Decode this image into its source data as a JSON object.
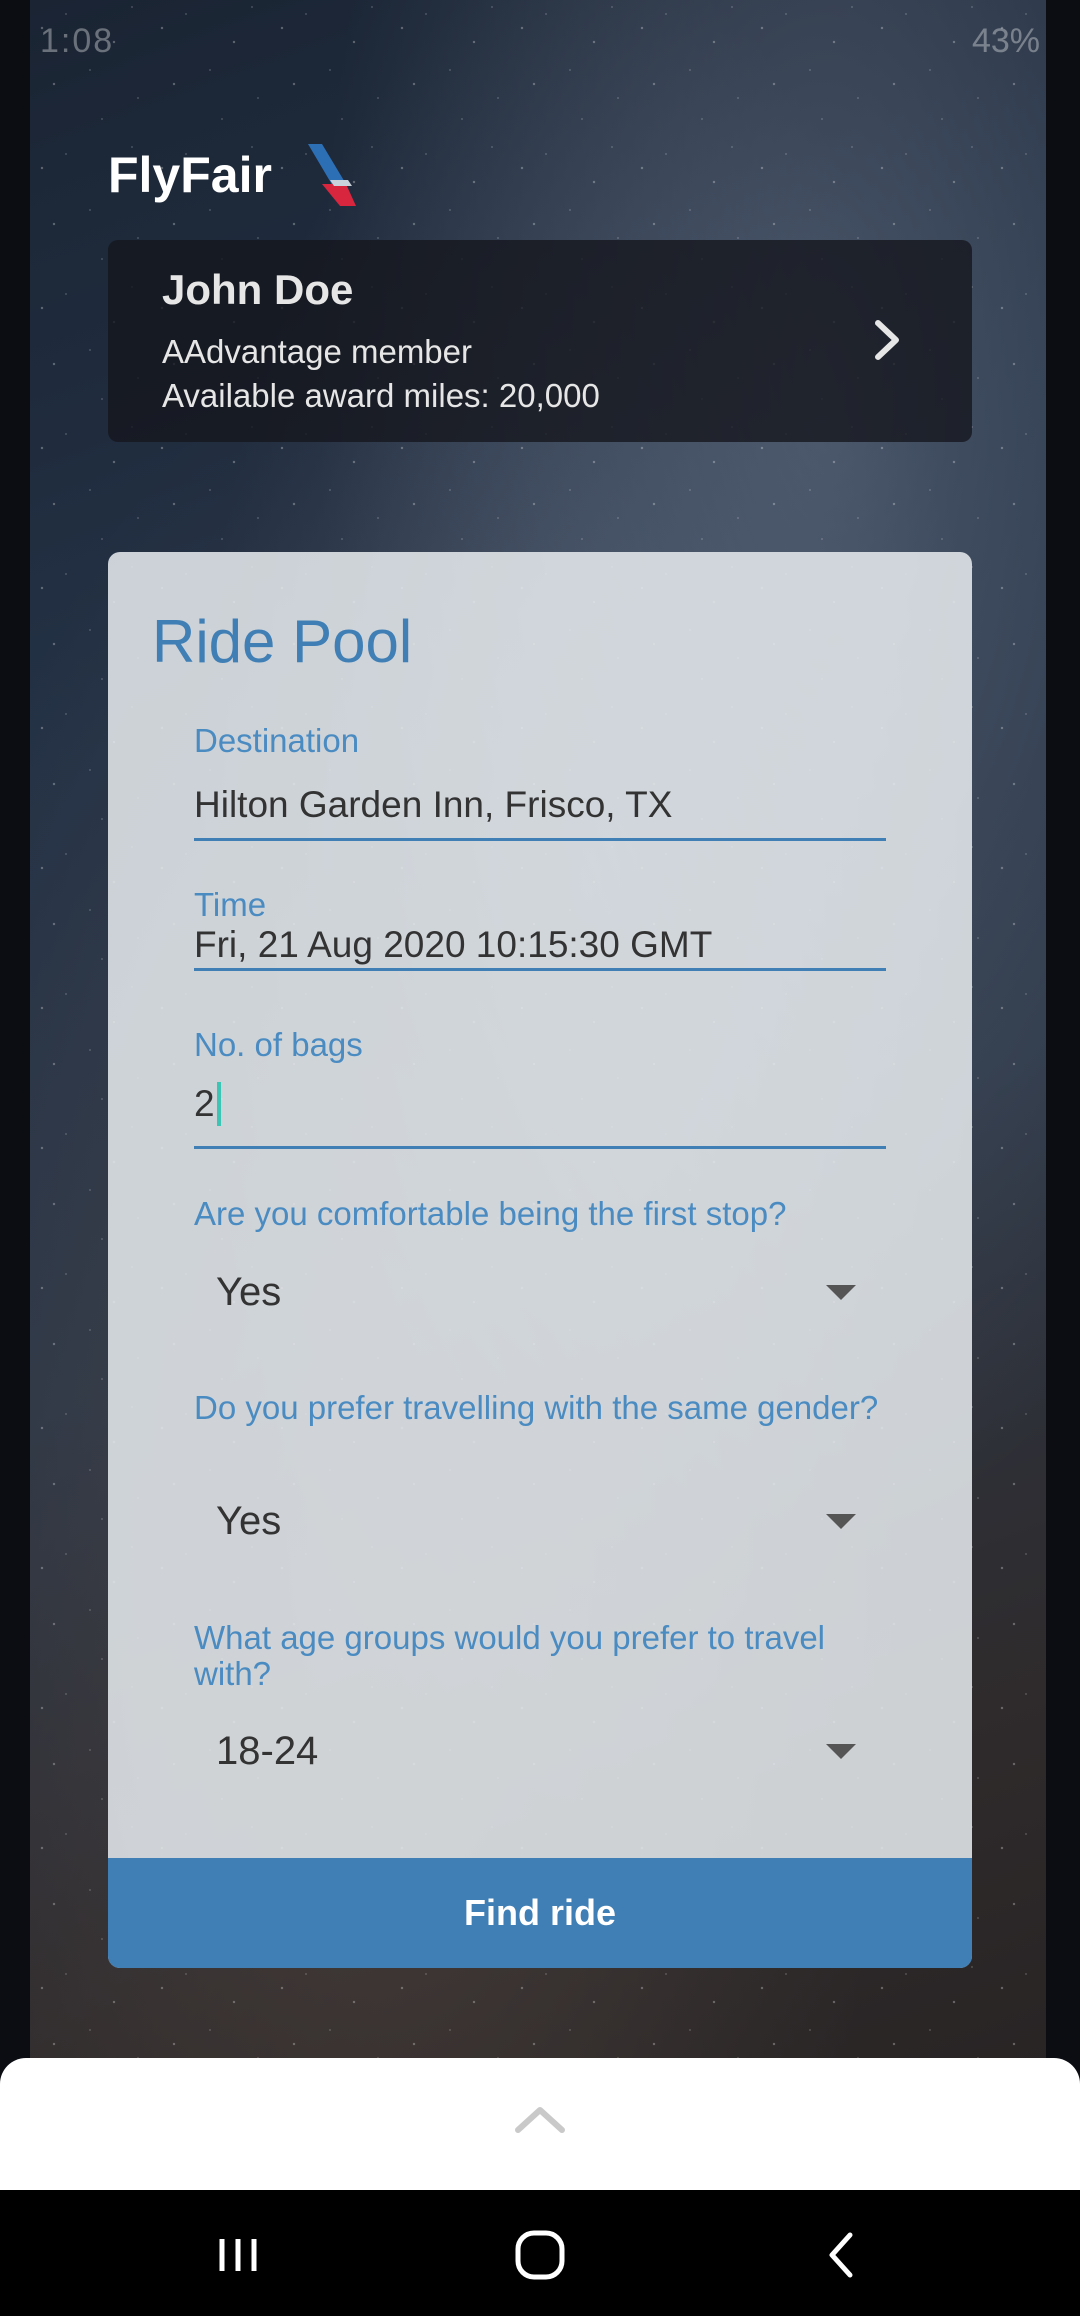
{
  "status_bar": {
    "time": "1:08",
    "battery": "43%"
  },
  "brand": {
    "name": "FlyFair"
  },
  "member": {
    "name": "John Doe",
    "tier": "AAdvantage member",
    "miles": "Available award miles: 20,000"
  },
  "form": {
    "title": "Ride Pool",
    "destination": {
      "label": "Destination",
      "value": "Hilton Garden Inn, Frisco, TX"
    },
    "time": {
      "label": "Time",
      "value": "Fri, 21 Aug 2020 10:15:30 GMT"
    },
    "bags": {
      "label": "No. of bags",
      "value": "2"
    },
    "first_stop": {
      "question": "Are you comfortable being the first stop?",
      "selected": "Yes"
    },
    "same_gender": {
      "question": "Do you prefer travelling with the same gender?",
      "selected": "Yes"
    },
    "age_group": {
      "question": "What age groups would you prefer to travel with?",
      "selected": "18-24"
    },
    "submit_label": "Find ride"
  },
  "colors": {
    "accent": "#3f7fb5",
    "label": "#4a8bc2",
    "cursor": "#3cc5b5"
  }
}
